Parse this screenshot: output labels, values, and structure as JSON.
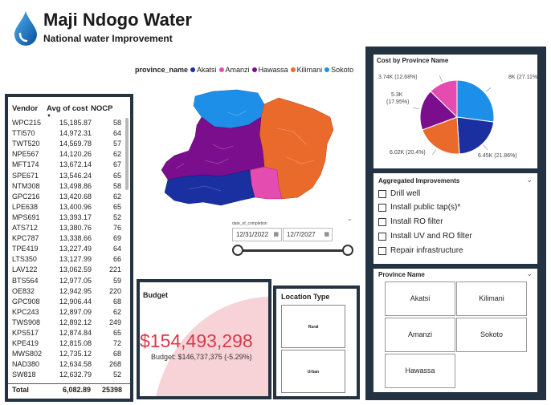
{
  "header": {
    "title": "Maji Ndogo Water",
    "subtitle": "National water Improvement"
  },
  "vendor_table": {
    "headers": [
      "Vendor",
      "Avg of cost",
      "NOCP"
    ],
    "rows": [
      [
        "WPC215",
        "15,185.87",
        "58"
      ],
      [
        "TTI570",
        "14,972.31",
        "64"
      ],
      [
        "TWT520",
        "14,569.78",
        "57"
      ],
      [
        "NPE567",
        "14,120.26",
        "62"
      ],
      [
        "MFT174",
        "13,672.14",
        "67"
      ],
      [
        "SPE671",
        "13,546.24",
        "65"
      ],
      [
        "NTM308",
        "13,498.86",
        "58"
      ],
      [
        "GPC216",
        "13,420.68",
        "62"
      ],
      [
        "LPE638",
        "13,400.96",
        "65"
      ],
      [
        "MPS691",
        "13,393.17",
        "52"
      ],
      [
        "ATS712",
        "13,380.76",
        "76"
      ],
      [
        "KPC787",
        "13,338.66",
        "69"
      ],
      [
        "TPE419",
        "13,227.49",
        "64"
      ],
      [
        "LTS350",
        "13,127.99",
        "66"
      ],
      [
        "LAV122",
        "13,062.59",
        "221"
      ],
      [
        "BTS564",
        "12,977.05",
        "59"
      ],
      [
        "OE832",
        "12,942.95",
        "220"
      ],
      [
        "GPC908",
        "12,906.44",
        "68"
      ],
      [
        "KPC243",
        "12,897.09",
        "62"
      ],
      [
        "TWS908",
        "12,892.12",
        "249"
      ],
      [
        "KPS517",
        "12,874.84",
        "65"
      ],
      [
        "KPE419",
        "12,815.08",
        "72"
      ],
      [
        "MWS802",
        "12,735.12",
        "68"
      ],
      [
        "NAD380",
        "12,634.58",
        "268"
      ],
      [
        "SW818",
        "12,632.79",
        "52"
      ]
    ],
    "total": {
      "label": "Total",
      "avg": "6,082.89",
      "nocp": "25398"
    }
  },
  "legend": {
    "title": "province_name",
    "items": [
      {
        "name": "Akatsi",
        "color": "#1a2fa0"
      },
      {
        "name": "Amanzi",
        "color": "#e44cb0"
      },
      {
        "name": "Hawassa",
        "color": "#7a0e8c"
      },
      {
        "name": "Kilimani",
        "color": "#ea6a2c"
      },
      {
        "name": "Sokoto",
        "color": "#1e8fe8"
      }
    ]
  },
  "date_filter": {
    "label": "date_of_completion",
    "start": "12/31/2022",
    "end": "12/7/2027"
  },
  "budget": {
    "title": "Budget",
    "value": "$154,493,298",
    "subtitle": "Budget: $146,737,375 (-5.29%)"
  },
  "location_type": {
    "title": "Location Type",
    "options": [
      "Rural",
      "Urban"
    ]
  },
  "chart_data": {
    "type": "pie",
    "title": "Cost by Province Name",
    "slices": [
      {
        "name": "Sokoto",
        "label": "8K (27.11%)",
        "value": 8000,
        "percent": 27.11,
        "color": "#1e8fe8"
      },
      {
        "name": "Akatsi",
        "label": "6.45K (21.86%)",
        "value": 6450,
        "percent": 21.86,
        "color": "#1a2fa0"
      },
      {
        "name": "Kilimani",
        "label": "6.02K (20.4%)",
        "value": 6020,
        "percent": 20.4,
        "color": "#ea6a2c"
      },
      {
        "name": "Hawassa",
        "label": "5.3K (17.95%)",
        "value": 5300,
        "percent": 17.95,
        "color": "#7a0e8c"
      },
      {
        "name": "Amanzi",
        "label": "3.74K (12.68%)",
        "value": 3740,
        "percent": 12.68,
        "color": "#e44cb0"
      }
    ]
  },
  "aggregated_improvements": {
    "title": "Aggregated Improvements",
    "items": [
      "Drill well",
      "Install public tap(s)*",
      "Install RO filter",
      "Install UV and RO filter",
      "Repair infrastructure"
    ]
  },
  "province_slicer": {
    "title": "Province Name",
    "items": [
      "Akatsi",
      "Kilimani",
      "Amanzi",
      "Sokoto",
      "Hawassa"
    ]
  }
}
